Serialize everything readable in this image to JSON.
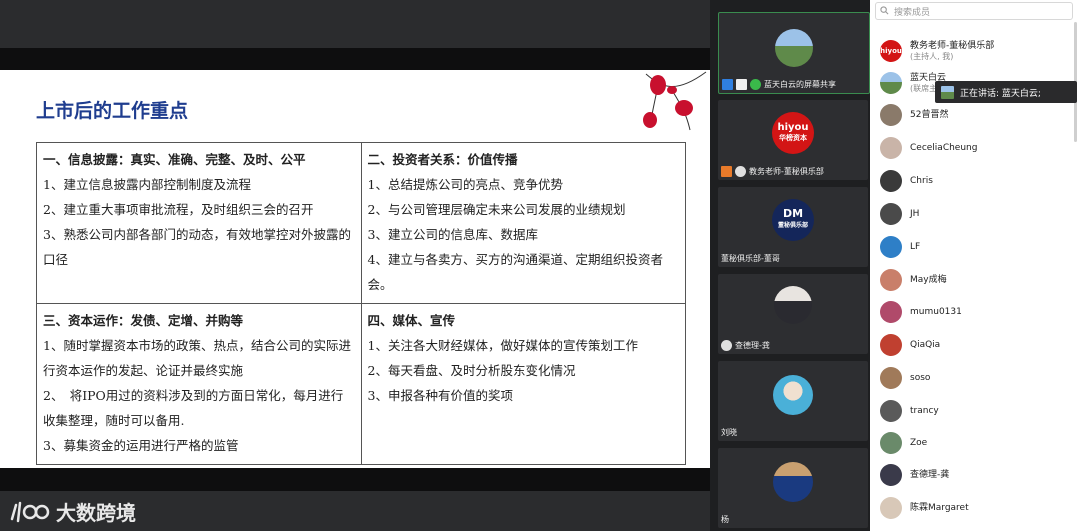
{
  "slide": {
    "title": "上市后的工作重点",
    "cells": [
      {
        "title": "一、信息披露：真实、准确、完整、及时、公平",
        "lines": [
          "1、建立信息披露内部控制制度及流程",
          "2、建立重大事项审批流程，及时组织三会的召开",
          "3、熟悉公司内部各部门的动态，有效地掌控对外披露的口径"
        ]
      },
      {
        "title": "二、投资者关系：价值传播",
        "lines": [
          "1、总结提炼公司的亮点、竞争优势",
          "2、与公司管理层确定未来公司发展的业绩规划",
          "3、建立公司的信息库、数据库",
          "4、建立与各卖方、买方的沟通渠道、定期组织投资者会。"
        ]
      },
      {
        "title": "三、资本运作：发债、定增、并购等",
        "lines": [
          "1、随时掌握资本市场的政策、热点，结合公司的实际进行资本运作的发起、论证并最终实施",
          "2、　将IPO用过的资料涉及到的方面日常化，每月进行收集整理，随时可以备用.",
          "3、募集资金的运用进行严格的监管"
        ]
      },
      {
        "title": "四、媒体、宣传",
        "lines": [
          "1、关注各大财经媒体，做好媒体的宣传策划工作",
          "2、每天看盘、及时分析股东变化情况",
          "3、申报各种有价值的奖项"
        ]
      }
    ]
  },
  "brand": {
    "logo_text": "大数跨境"
  },
  "tiles": [
    {
      "label": "蓝天白云的屏幕共享"
    },
    {
      "label": "教务老师-董秘俱乐部",
      "logo_line1": "hiyou",
      "logo_line2": "华榜资本"
    },
    {
      "label": "董秘俱乐部-董哥",
      "logo_line1": "DM",
      "logo_line2": "董秘俱乐部"
    },
    {
      "label": "查德理-龚"
    },
    {
      "label": "刘晓"
    },
    {
      "label": "杨"
    }
  ],
  "members_panel": {
    "search_placeholder": "搜索成员",
    "speaking": "正在讲话: 蓝天白云;",
    "members": [
      {
        "name": "教务老师-董秘俱乐部",
        "sub": "(主持人, 我)",
        "color": "#d31515"
      },
      {
        "name": "蓝天白云",
        "sub": "(联席主持人)",
        "color": "#7a9a6a"
      },
      {
        "name": "52曾晋然",
        "sub": "",
        "color": "#8a7a6a"
      },
      {
        "name": "CeceliaCheung",
        "sub": "",
        "color": "#c9b4a8"
      },
      {
        "name": "Chris",
        "sub": "",
        "color": "#3a3a3a"
      },
      {
        "name": "JH",
        "sub": "",
        "color": "#4a4a4a"
      },
      {
        "name": "LF",
        "sub": "",
        "color": "#2e7fc7"
      },
      {
        "name": "May成梅",
        "sub": "",
        "color": "#c97f6a"
      },
      {
        "name": "mumu0131",
        "sub": "",
        "color": "#b04a6a"
      },
      {
        "name": "QiaQia",
        "sub": "",
        "color": "#c04030"
      },
      {
        "name": "soso",
        "sub": "",
        "color": "#a07a5a"
      },
      {
        "name": "trancy",
        "sub": "",
        "color": "#5a5a5a"
      },
      {
        "name": "Zoe",
        "sub": "",
        "color": "#6a8a6a"
      },
      {
        "name": "查德理-龚",
        "sub": "",
        "color": "#3a3a4a"
      },
      {
        "name": "陈霖Margaret",
        "sub": "",
        "color": "#d8c8b8"
      }
    ]
  },
  "colors": {
    "title_blue": "#1f3d8f",
    "active_green": "#3a8c4f",
    "host_red": "#d31515",
    "flower_red": "#c8102e"
  }
}
